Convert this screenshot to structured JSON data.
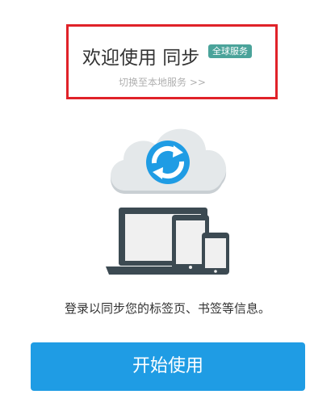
{
  "header": {
    "title": "欢迎使用 同步",
    "badge": "全球服务",
    "switch_link": "切换至本地服务 >>"
  },
  "illustration": {
    "cloud_icon": "cloud-sync-icon",
    "devices_icon": "devices-icon"
  },
  "description": "登录以同步您的标签页、书签等信息。",
  "start_button": "开始使用",
  "colors": {
    "accent": "#1f9ce4",
    "badge": "#4aa39a",
    "highlight": "#e02229",
    "device": "#3c4a52"
  }
}
